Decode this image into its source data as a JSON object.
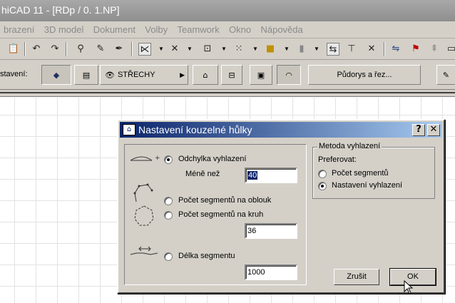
{
  "window": {
    "title": "hiCAD 11 - [RDp / 0. 1.NP]"
  },
  "menu": [
    "brazení",
    "3D model",
    "Dokument",
    "Volby",
    "Teamwork",
    "Okno",
    "Nápověda"
  ],
  "toolbar2": {
    "left_label": "stavení:",
    "layer_label": "STŘECHY",
    "view_button": "Půdorys a řez..."
  },
  "dialog": {
    "title": "Nastavení kouzelné hůlky",
    "help_button": "?",
    "close_button": "✕",
    "options": {
      "deviation": "Odchylka vyhlazení",
      "less_than": "Méně než",
      "less_than_value": "40",
      "segments_arc": "Počet segmentů na oblouk",
      "segments_circle": "Počet segmentů na kruh",
      "segments_circle_value": "36",
      "segment_length": "Délka segmentu",
      "segment_length_value": "1000"
    },
    "method": {
      "legend": "Metoda vyhlazení",
      "prefer": "Preferovat:",
      "segment_count": "Počet segmentů",
      "smoothing_setting": "Nastavení vyhlazení"
    },
    "cancel_button": "Zrušit",
    "ok_button": "OK"
  },
  "icons": {
    "toolbar": [
      "paste-icon",
      "undo-icon",
      "redo-icon",
      "zoom-icon",
      "pipette-icon",
      "inject-icon",
      "magic-wand-icon",
      "snap-icon",
      "layer-icon",
      "grid-icon",
      "color-icon",
      "pen-icon",
      "marquee-icon",
      "dimension-icon",
      "close-icon",
      "flip-icon",
      "flag-icon",
      "pin-icon",
      "window-icon"
    ]
  }
}
